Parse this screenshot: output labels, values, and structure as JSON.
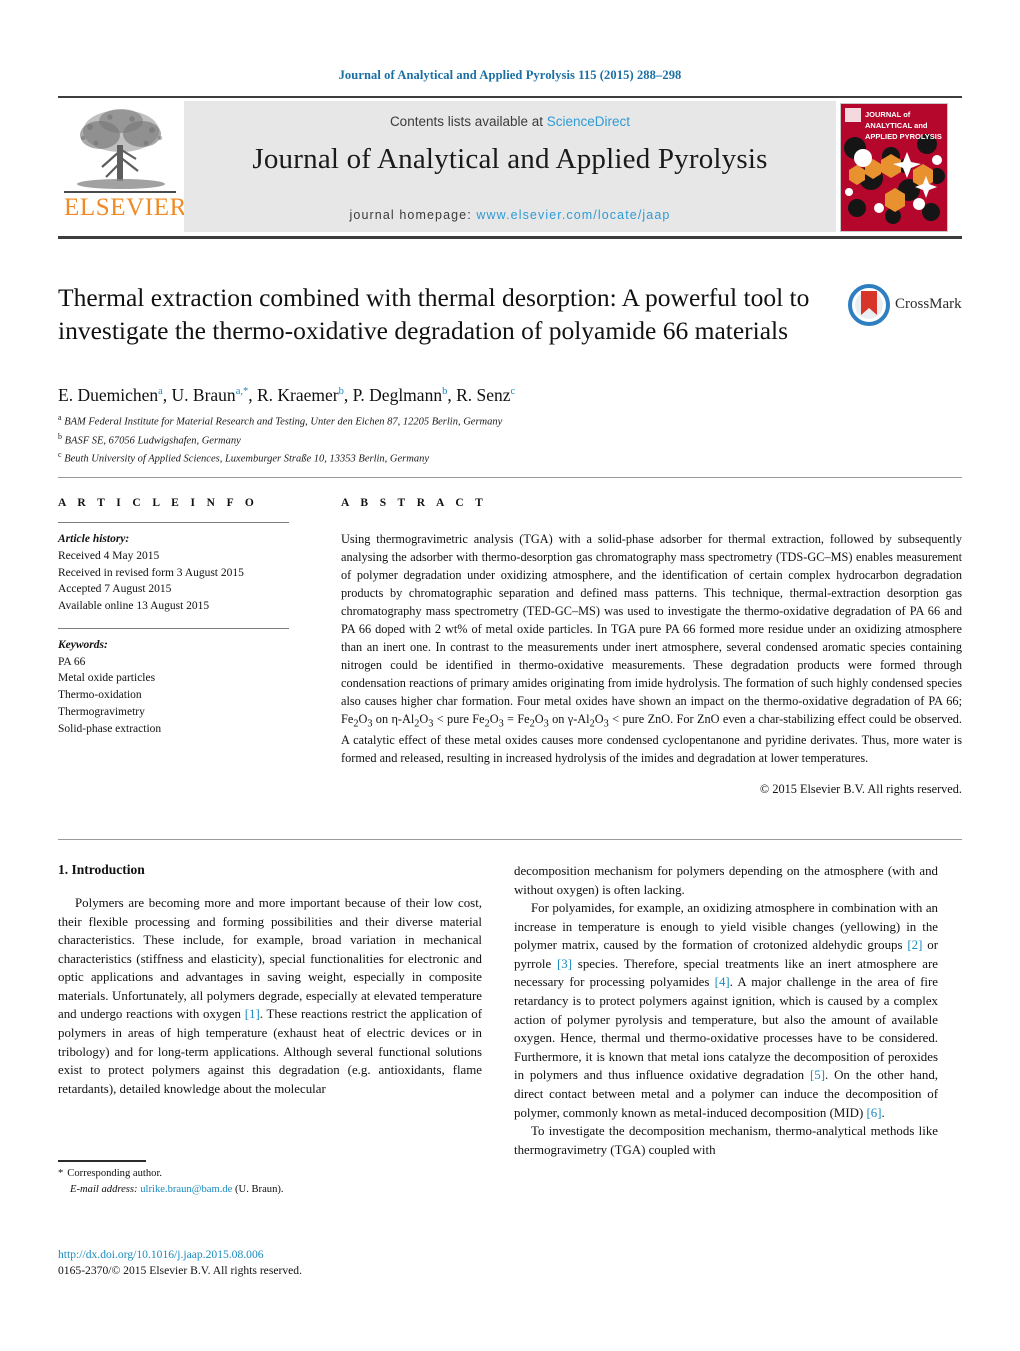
{
  "running_head": "Journal of Analytical and Applied Pyrolysis 115 (2015) 288–298",
  "masthead": {
    "contents_prefix": "Contents lists available at ",
    "sciencedirect": "ScienceDirect",
    "journal_title": "Journal of Analytical and Applied Pyrolysis",
    "homepage_prefix": "journal homepage: ",
    "homepage_url": "www.elsevier.com/locate/jaap",
    "publisher": "ELSEVIER",
    "cover_line1": "JOURNAL of",
    "cover_line2": "ANALYTICAL and",
    "cover_line3": "APPLIED PYROLYSIS",
    "colors": {
      "link": "#2e9bd6",
      "elsevier_orange": "#f08a24",
      "cover_red": "#b4072b",
      "cover_orange": "#e8912f",
      "panel_grey": "#e7e7e7"
    }
  },
  "article": {
    "title": "Thermal extraction combined with thermal desorption: A powerful tool to investigate the thermo-oxidative degradation of polyamide 66 materials",
    "crossmark_label": "CrossMark",
    "authors_html": "E. Duemichen<sup>a</sup>, U. Braun<sup>a,*</sup>, R. Kraemer<sup>b</sup>, P. Deglmann<sup>b</sup>, R. Senz<sup>c</sup>",
    "affiliations": [
      {
        "marker": "a",
        "text": "BAM Federal Institute for Material Research and Testing, Unter den Eichen 87, 12205 Berlin, Germany"
      },
      {
        "marker": "b",
        "text": "BASF SE, 67056 Ludwigshafen, Germany"
      },
      {
        "marker": "c",
        "text": "Beuth University of Applied Sciences, Luxemburger Straße 10, 13353 Berlin, Germany"
      }
    ]
  },
  "article_info": {
    "heading": "A R T I C L E   I N F O",
    "history_label": "Article history:",
    "history": [
      "Received 4 May 2015",
      "Received in revised form 3 August 2015",
      "Accepted 7 August 2015",
      "Available online 13 August 2015"
    ],
    "keywords_label": "Keywords:",
    "keywords": [
      "PA 66",
      "Metal oxide particles",
      "Thermo-oxidation",
      "Thermogravimetry",
      "Solid-phase extraction"
    ]
  },
  "abstract": {
    "heading": "A B S T R A C T",
    "text": "Using thermogravimetric analysis (TGA) with a solid-phase adsorber for thermal extraction, followed by subsequently analysing the adsorber with thermo-desorption gas chromatography mass spectrometry (TDS-GC–MS) enables measurement of polymer degradation under oxidizing atmosphere, and the identification of certain complex hydrocarbon degradation products by chromatographic separation and defined mass patterns. This technique, thermal-extraction desorption gas chromatography mass spectrometry (TED-GC–MS) was used to investigate the thermo-oxidative degradation of PA 66 and PA 66 doped with 2 wt% of metal oxide particles. In TGA pure PA 66 formed more residue under an oxidizing atmosphere than an inert one. In contrast to the measurements under inert atmosphere, several condensed aromatic species containing nitrogen could be identified in thermo-oxidative measurements. These degradation products were formed through condensation reactions of primary amides originating from imide hydrolysis. The formation of such highly condensed species also causes higher char formation. Four metal oxides have shown an impact on the thermo-oxidative degradation of PA 66; Fe2O3 on η-Al2O3 < pure Fe2O3 = Fe2O3 on γ-Al2O3 < pure ZnO. For ZnO even a char-stabilizing effect could be observed. A catalytic effect of these metal oxides causes more condensed cyclopentanone and pyridine derivates. Thus, more water is formed and released, resulting in increased hydrolysis of the imides and degradation at lower temperatures.",
    "copyright": "© 2015 Elsevier B.V. All rights reserved."
  },
  "introduction": {
    "heading": "1.  Introduction",
    "left_paragraph": "Polymers are becoming more and more important because of their low cost, their flexible processing and forming possibilities and their diverse material characteristics. These include, for example, broad variation in mechanical characteristics (stiffness and elasticity), special functionalities for electronic and optic applications and advantages in saving weight, especially in composite materials. Unfortunately, all polymers degrade, especially at elevated temperature and undergo reactions with oxygen [1]. These reactions restrict the application of polymers in areas of high temperature (exhaust heat of electric devices or in tribology) and for long-term applications. Although several functional solutions exist to protect polymers against this degradation (e.g. antioxidants, flame retardants), detailed knowledge about the molecular",
    "right_paragraph_1": "decomposition mechanism for polymers depending on the atmosphere (with and without oxygen) is often lacking.",
    "right_paragraph_2": "For polyamides, for example, an oxidizing atmosphere in combination with an increase in temperature is enough to yield visible changes (yellowing) in the polymer matrix, caused by the formation of crotonized aldehydic groups [2] or pyrrole [3] species. Therefore, special treatments like an inert atmosphere are necessary for processing polyamides [4]. A major challenge in the area of fire retardancy is to protect polymers against ignition, which is caused by a complex action of polymer pyrolysis and temperature, but also the amount of available oxygen. Hence, thermal und thermo-oxidative processes have to be considered. Furthermore, it is known that metal ions catalyze the decomposition of peroxides in polymers and thus influence oxidative degradation [5]. On the other hand, direct contact between metal and a polymer can induce the decomposition of polymer, commonly known as metal-induced decomposition (MID) [6].",
    "right_paragraph_3": "To investigate the decomposition mechanism, thermo-analytical methods like thermogravimetry (TGA) coupled with"
  },
  "footer": {
    "corresponding_star": "*",
    "corresponding_label": "Corresponding author.",
    "email_label": "E-mail address:",
    "email": "ulrike.braun@bam.de",
    "email_suffix": "(U. Braun).",
    "doi": "http://dx.doi.org/10.1016/j.jaap.2015.08.006",
    "issn_line": "0165-2370/© 2015 Elsevier B.V. All rights reserved."
  }
}
